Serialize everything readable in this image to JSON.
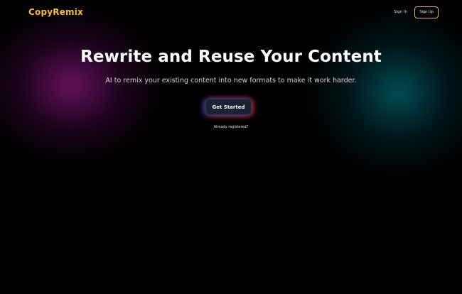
{
  "header": {
    "logo": "CopyRemix",
    "signin_label": "Sign In",
    "signup_label": "Sign Up"
  },
  "hero": {
    "title": "Rewrite and Reuse Your Content",
    "subtitle": "AI to remix your existing content into new formats to make it work harder.",
    "cta_label": "Get Started",
    "already_registered": "Already registered?"
  },
  "colors": {
    "background": "#000000",
    "logo": "#f4bf2f",
    "signup_border": "#e3b634",
    "cta_background": "#1b2233",
    "glow_left": "#78146e",
    "glow_right": "#005a64"
  }
}
